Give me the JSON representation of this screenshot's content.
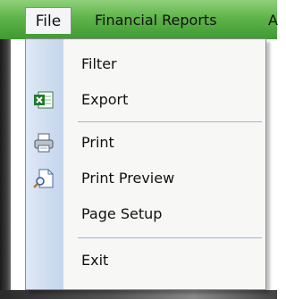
{
  "menubar": {
    "file_label": "File",
    "reports_label": "Financial Reports",
    "more_label": "A"
  },
  "menu": {
    "items": [
      {
        "label": "Filter",
        "icon": null
      },
      {
        "label": "Export",
        "icon": "excel-export-icon"
      },
      {
        "label": "Print",
        "icon": "printer-icon"
      },
      {
        "label": "Print Preview",
        "icon": "print-preview-icon"
      },
      {
        "label": "Page Setup",
        "icon": null
      },
      {
        "label": "Exit",
        "icon": null
      }
    ]
  },
  "colors": {
    "menubar_green": "#5fb44a",
    "icon_column": "#c4d4ec",
    "separator": "#9fb3d6"
  }
}
